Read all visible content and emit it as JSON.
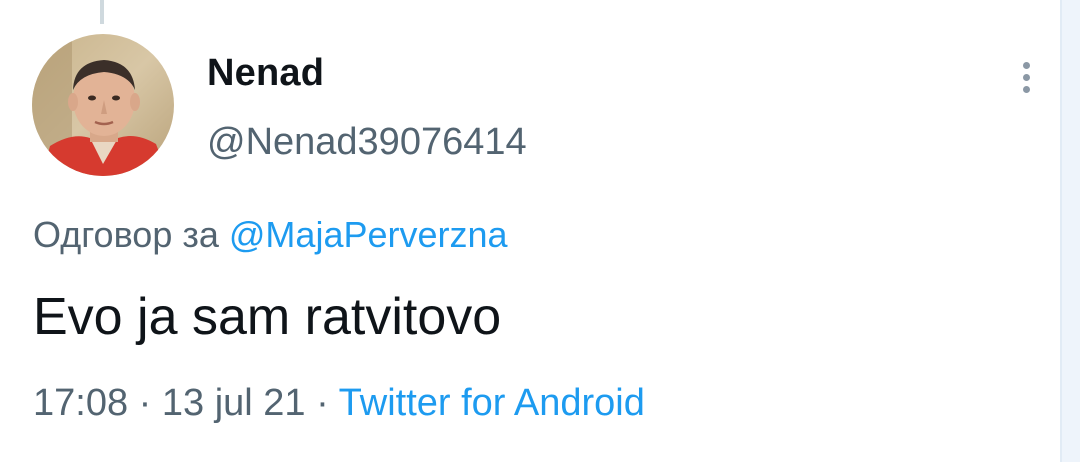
{
  "tweet": {
    "author": {
      "display_name": "Nenad",
      "handle": "@Nenad39076414"
    },
    "reply": {
      "prefix": "Одговор за",
      "mention": "@MajaPerverzna"
    },
    "text": "Evo ja sam ratvitovo",
    "meta": {
      "time": "17:08",
      "separator": "·",
      "date": "13 jul 21",
      "source": "Twitter for Android"
    }
  },
  "icons": {
    "more": "more-vertical-icon",
    "avatar": "profile-photo"
  },
  "colors": {
    "text_primary": "#0f1419",
    "text_secondary": "#536471",
    "accent": "#1d9bf0"
  }
}
